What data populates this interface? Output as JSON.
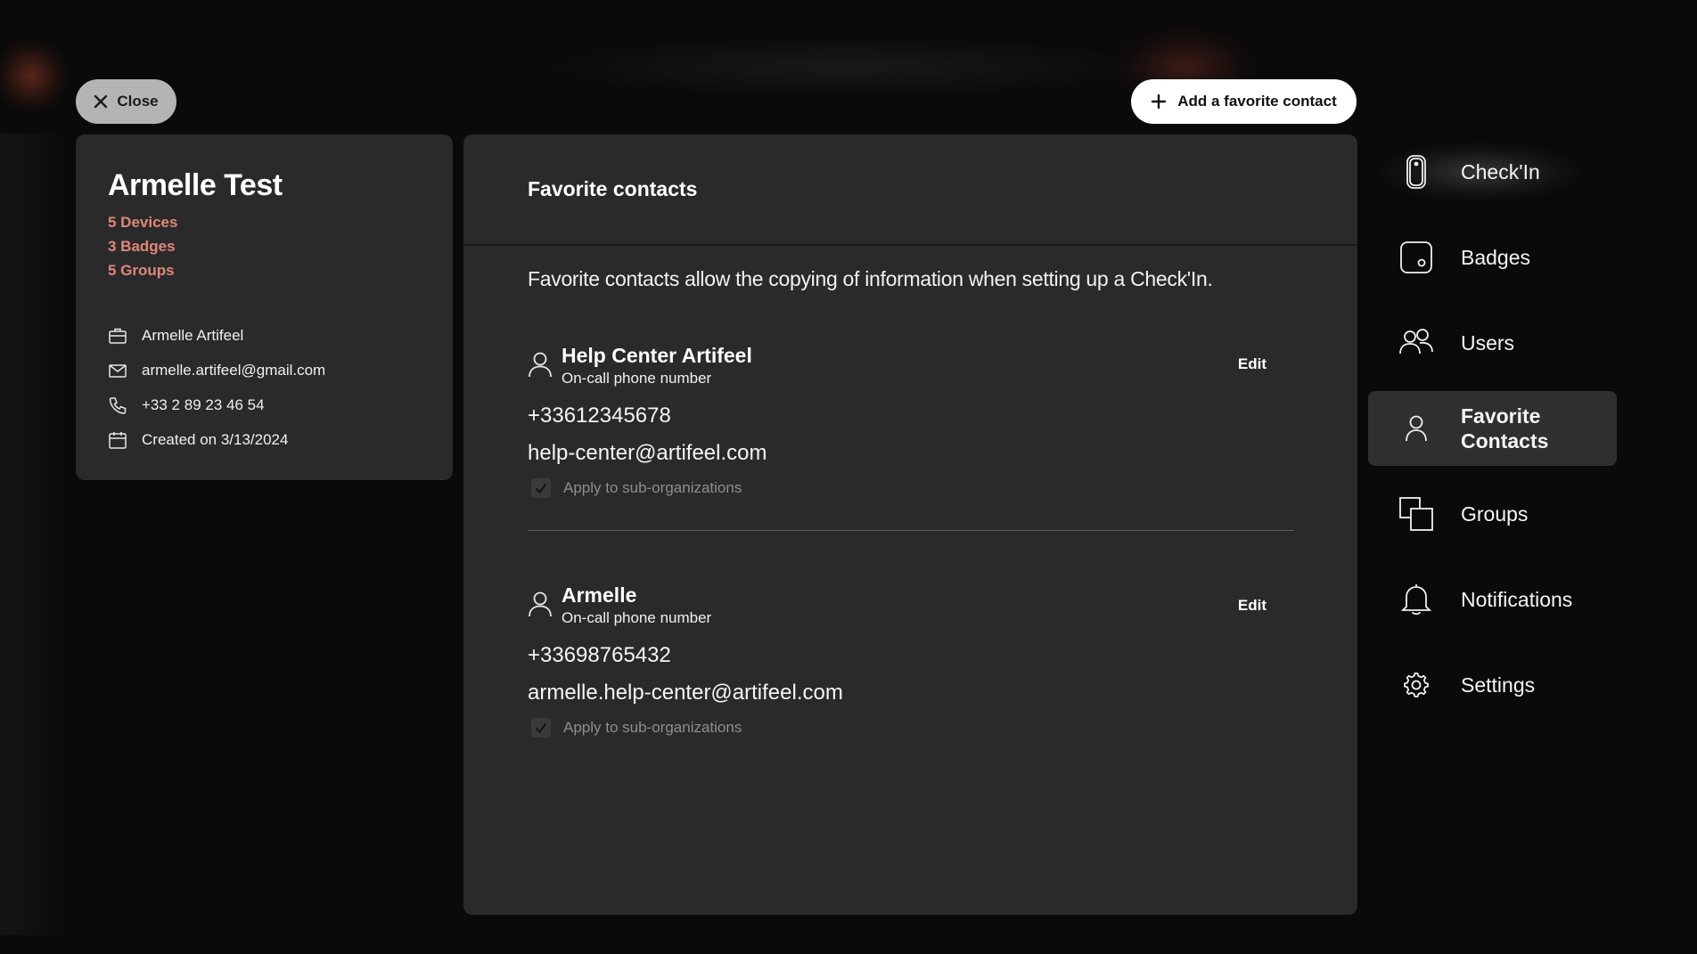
{
  "header": {
    "close_label": "Close",
    "add_contact_label": "Add a favorite contact"
  },
  "profile": {
    "name": "Armelle Test",
    "stats": [
      "5 Devices",
      "3 Badges",
      "5 Groups"
    ],
    "organization": "Armelle Artifeel",
    "email": "armelle.artifeel@gmail.com",
    "phone": "+33 2 89 23 46 54",
    "created": "Created on 3/13/2024"
  },
  "panel": {
    "title": "Favorite contacts",
    "description": "Favorite contacts allow the copying of information when setting up a Check'In.",
    "edit_label": "Edit",
    "contacts": [
      {
        "name": "Help Center Artifeel",
        "type": "On-call phone number",
        "phone": "+33612345678",
        "email": "help-center@artifeel.com",
        "apply_label": "Apply to sub-organizations",
        "apply_checked": true
      },
      {
        "name": "Armelle",
        "type": "On-call phone number",
        "phone": "+33698765432",
        "email": "armelle.help-center@artifeel.com",
        "apply_label": "Apply to sub-organizations",
        "apply_checked": true
      }
    ]
  },
  "nav": {
    "items": [
      {
        "label": "Check'In",
        "icon": "device-icon"
      },
      {
        "label": "Badges",
        "icon": "badge-icon"
      },
      {
        "label": "Users",
        "icon": "users-icon"
      },
      {
        "label": "Favorite Contacts",
        "icon": "user-icon",
        "active": true
      },
      {
        "label": "Groups",
        "icon": "groups-icon"
      },
      {
        "label": "Notifications",
        "icon": "bell-icon"
      },
      {
        "label": "Settings",
        "icon": "gear-icon"
      }
    ]
  },
  "colors": {
    "accent": "#e0877a",
    "panel_bg": "#2a2a2a",
    "page_bg": "#0a0a0a"
  }
}
